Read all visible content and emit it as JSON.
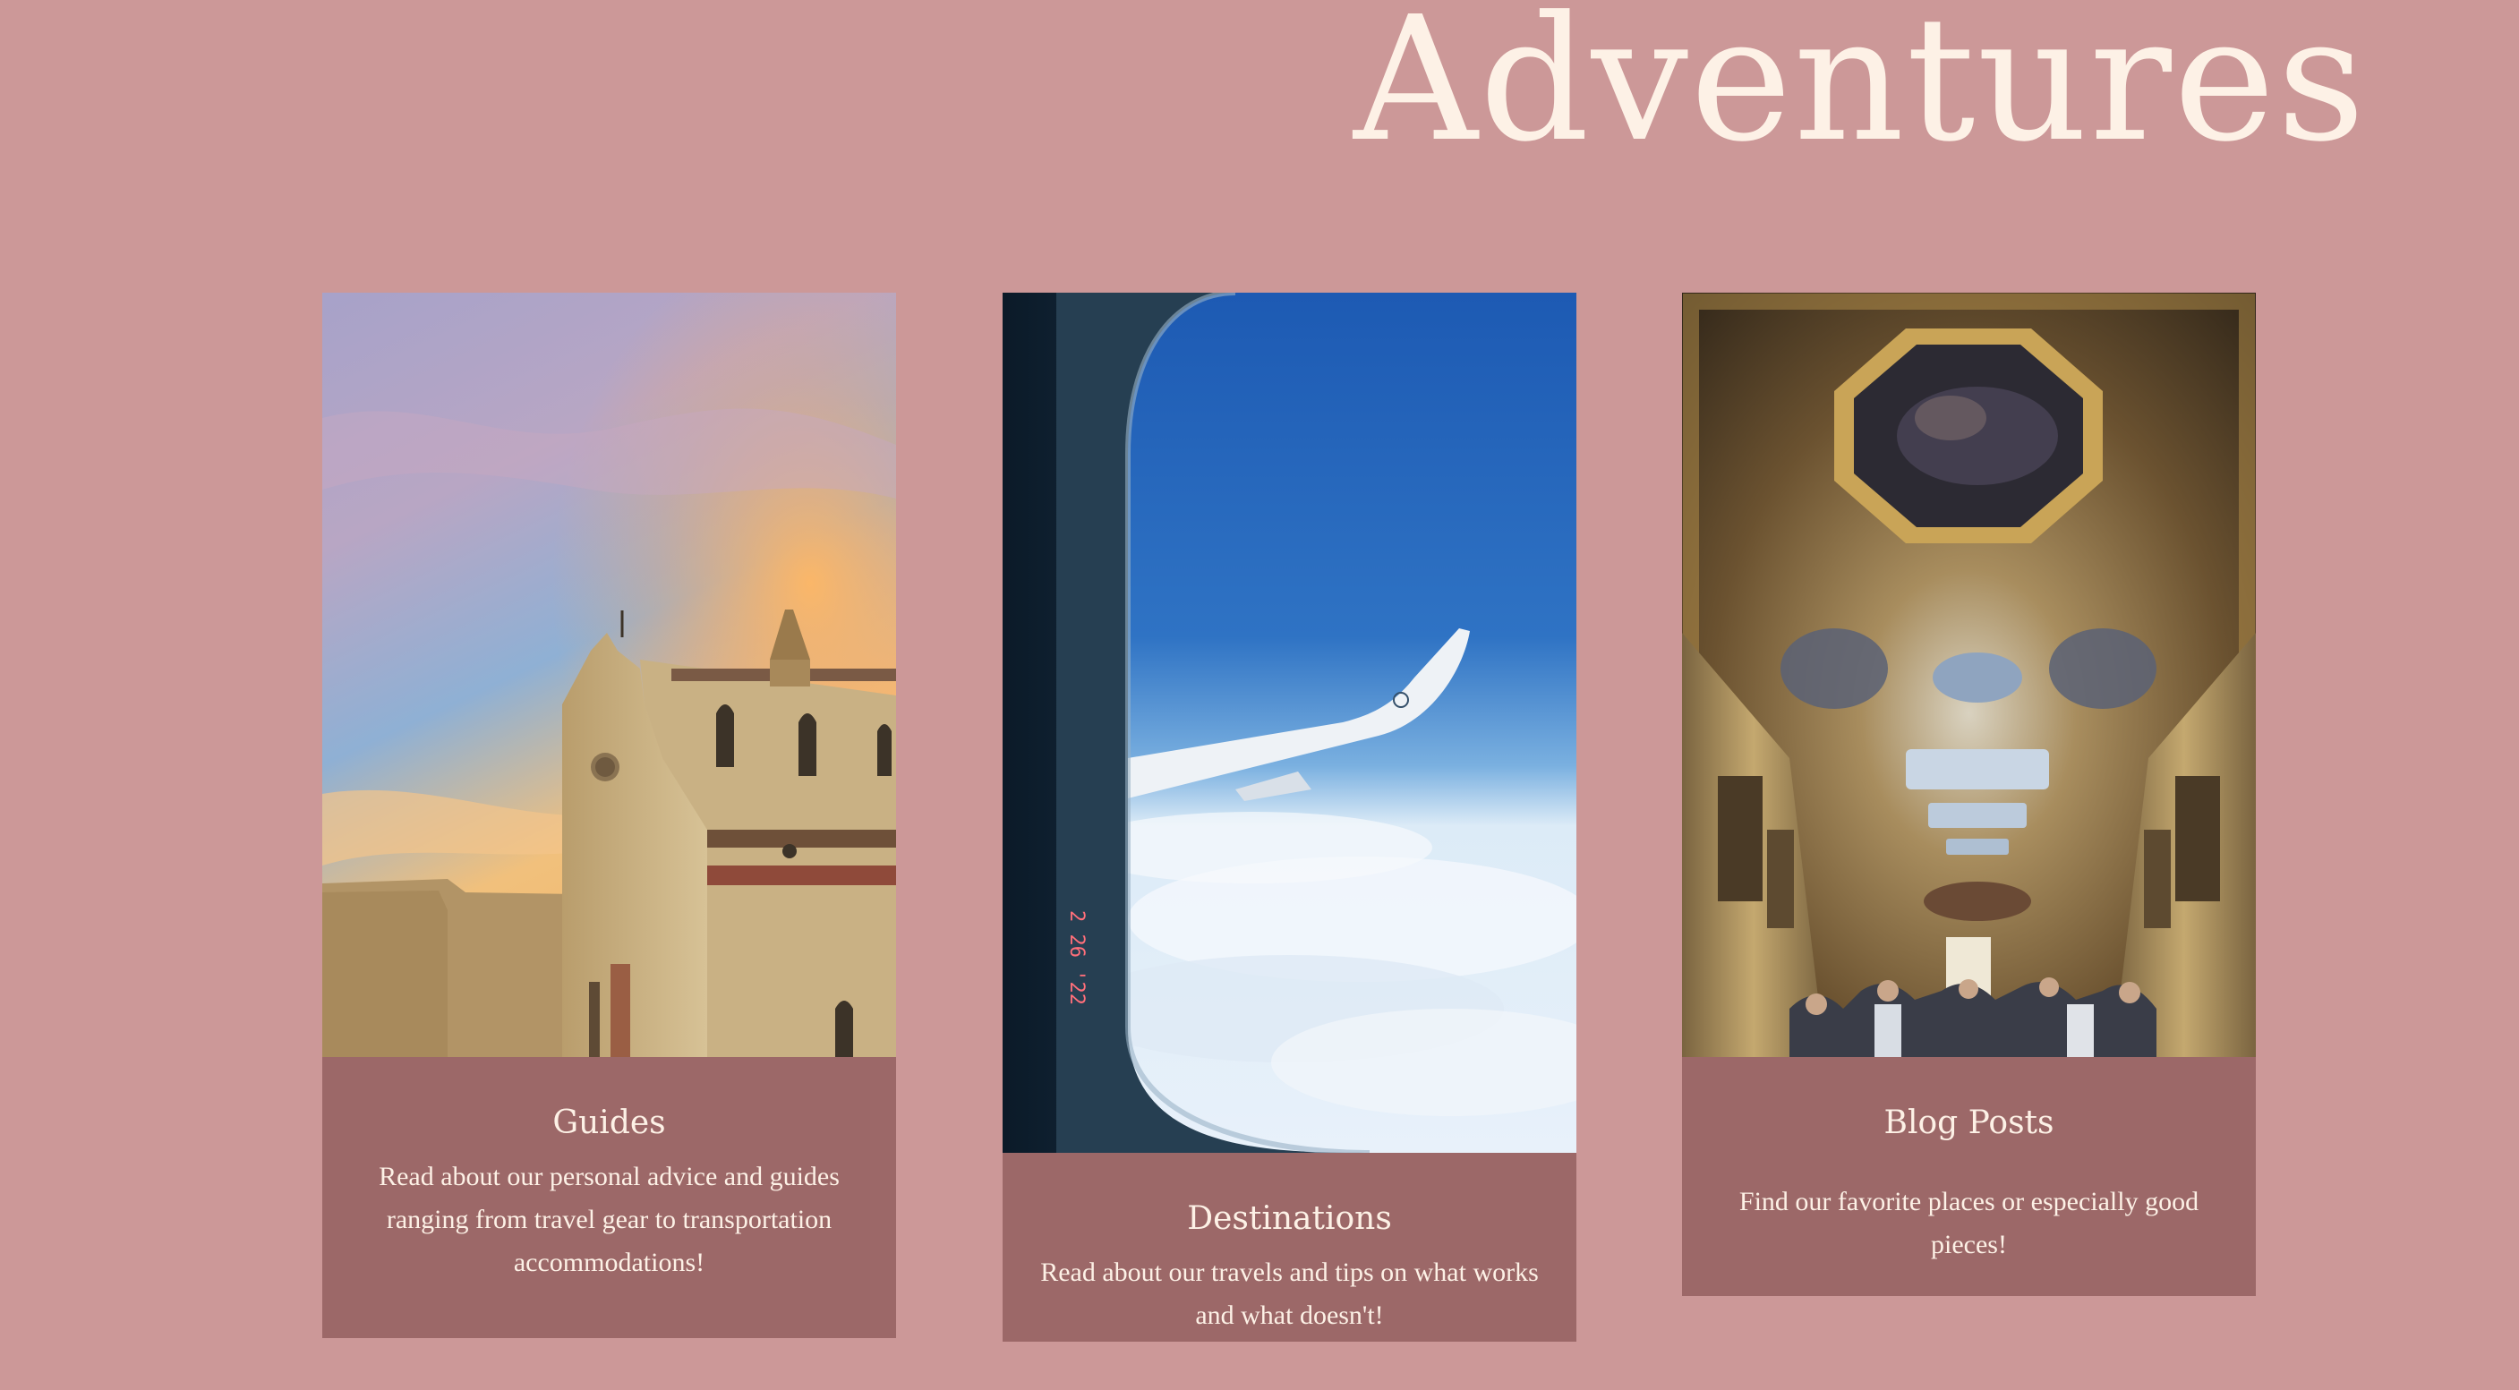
{
  "header": {
    "title": "Adventures"
  },
  "cards": [
    {
      "title": "Guides",
      "text": "Read about our personal advice and guides ranging from travel gear to transportation accommodations!",
      "image": "church-at-sunset-photo"
    },
    {
      "title": "Destinations",
      "text": "Read about our travels and tips on what works and what doesn't!",
      "image": "airplane-window-wing-photo",
      "photo_stamp": "2 26 '22"
    },
    {
      "title": "Blog Posts",
      "text": "Find our favorite places or especially good pieces!",
      "image": "ornate-gallery-ceiling-photo"
    }
  ],
  "colors": {
    "page_background": "#cc9898",
    "card_body_background": "#9c6868",
    "text_cream": "#fdf1e6",
    "photo_stamp": "#ff6f7a"
  }
}
